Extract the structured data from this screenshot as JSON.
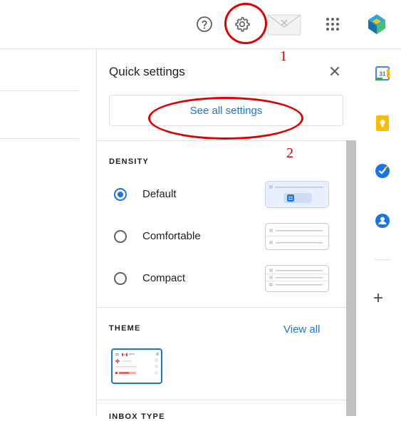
{
  "topbar": {
    "help_icon": "help-circle-icon",
    "settings_icon": "gear-icon",
    "apps_icon": "apps-grid-icon"
  },
  "annotations": {
    "step1": "1",
    "step2": "2"
  },
  "quick_settings": {
    "title": "Quick settings",
    "close_label": "✕",
    "see_all_label": "See all settings",
    "density": {
      "label": "DENSITY",
      "options": [
        {
          "label": "Default",
          "selected": true
        },
        {
          "label": "Comfortable",
          "selected": false
        },
        {
          "label": "Compact",
          "selected": false
        }
      ]
    },
    "theme": {
      "label": "THEME",
      "view_all_label": "View all"
    },
    "next_section_label": "INBOX TYPE"
  },
  "side_rail": {
    "add_label": "+"
  },
  "colors": {
    "accent": "#1a73e8",
    "annotation": "#e00000"
  }
}
